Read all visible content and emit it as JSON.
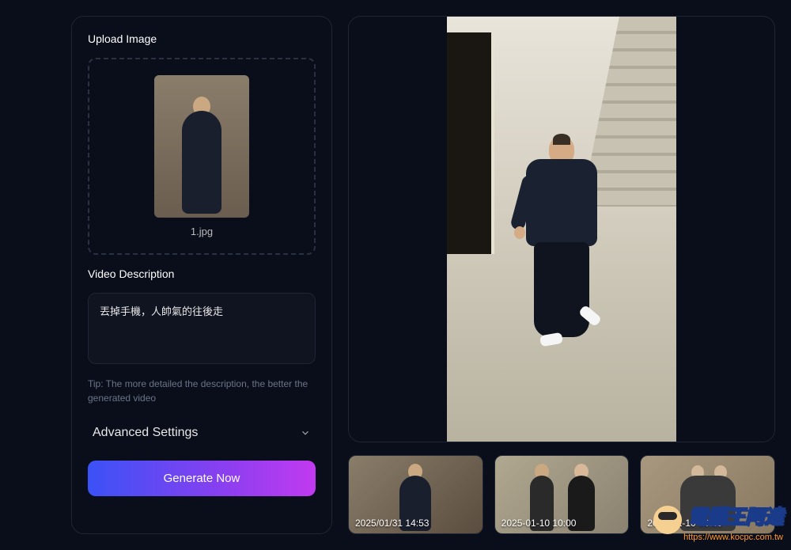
{
  "left": {
    "upload_label": "Upload Image",
    "filename": "1.jpg",
    "description_label": "Video Description",
    "description_value": "丟掉手機，人帥氣的往後走",
    "tip": "Tip: The more detailed the description, the better the generated video",
    "advanced_label": "Advanced Settings",
    "generate_label": "Generate Now"
  },
  "thumbnails": [
    {
      "time": "2025/01/31 14:53"
    },
    {
      "time": "2025-01-10 10:00"
    },
    {
      "time": "2025-01-10 09:30"
    }
  ],
  "watermark": {
    "main": "電腦王阿達",
    "sub": "https://www.kocpc.com.tw"
  }
}
